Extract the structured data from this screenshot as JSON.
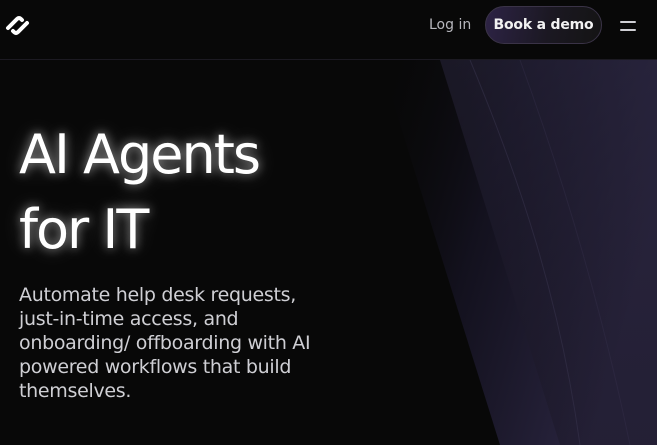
{
  "header": {
    "login_label": "Log in",
    "cta_label": "Book a demo",
    "logo_icon": "brand-logo-icon",
    "menu_icon": "hamburger-menu-icon"
  },
  "hero": {
    "title_line1": "AI Agents",
    "title_line2": "for IT",
    "description_lines": [
      "Automate help desk requests,",
      "just-in-time access, and",
      "onboarding/ offboarding with AI",
      "powered workflows that build",
      "themselves."
    ]
  },
  "colors": {
    "background": "#080808",
    "accent_purple": "#2d2345",
    "text_primary": "#ffffff",
    "text_secondary": "#cfcfd4"
  }
}
